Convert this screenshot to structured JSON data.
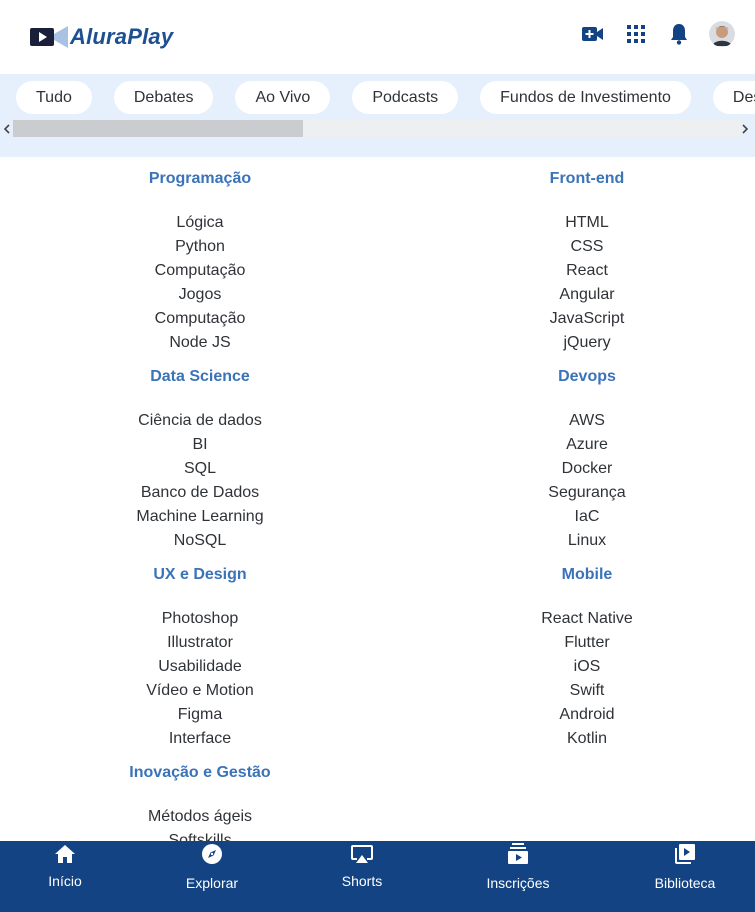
{
  "header": {
    "logo_text": "AluraPlay",
    "icons": [
      "add-video-icon",
      "apps-grid-icon",
      "notification-bell-icon",
      "avatar"
    ]
  },
  "chips": [
    {
      "label": "Tudo"
    },
    {
      "label": "Debates"
    },
    {
      "label": "Ao Vivo"
    },
    {
      "label": "Podcasts"
    },
    {
      "label": "Fundos de Investimento"
    },
    {
      "label": "Desenho"
    }
  ],
  "menu": {
    "left": [
      {
        "title": "Programação",
        "items": [
          "Lógica",
          "Python",
          "Computação",
          "Jogos",
          "Computação",
          "Node JS"
        ]
      },
      {
        "title": "Data Science",
        "items": [
          "Ciência de dados",
          "BI",
          "SQL",
          "Banco de Dados",
          "Machine Learning",
          "NoSQL"
        ]
      },
      {
        "title": "UX e Design",
        "items": [
          "Photoshop",
          "Illustrator",
          "Usabilidade",
          "Vídeo e Motion",
          "Figma",
          "Interface"
        ]
      },
      {
        "title": "Inovação e Gestão",
        "items": [
          "Métodos ágeis",
          "Softskills"
        ]
      }
    ],
    "right": [
      {
        "title": "Front-end",
        "items": [
          "HTML",
          "CSS",
          "React",
          "Angular",
          "JavaScript",
          "jQuery"
        ]
      },
      {
        "title": "Devops",
        "items": [
          "AWS",
          "Azure",
          "Docker",
          "Segurança",
          "IaC",
          "Linux"
        ]
      },
      {
        "title": "Mobile",
        "items": [
          "React Native",
          "Flutter",
          "iOS",
          "Swift",
          "Android",
          "Kotlin"
        ]
      }
    ]
  },
  "bottom_nav": [
    {
      "label": "Início",
      "icon": "home-icon"
    },
    {
      "label": "Explorar",
      "icon": "compass-icon"
    },
    {
      "label": "Shorts",
      "icon": "cast-screen-icon"
    },
    {
      "label": "Inscrições",
      "icon": "subscriptions-icon"
    },
    {
      "label": "Biblioteca",
      "icon": "library-icon"
    }
  ],
  "colors": {
    "brand": "#1d4f91",
    "chip_band": "#e6f0fc",
    "group_title": "#3b73b9",
    "bottom_nav": "#134382"
  }
}
